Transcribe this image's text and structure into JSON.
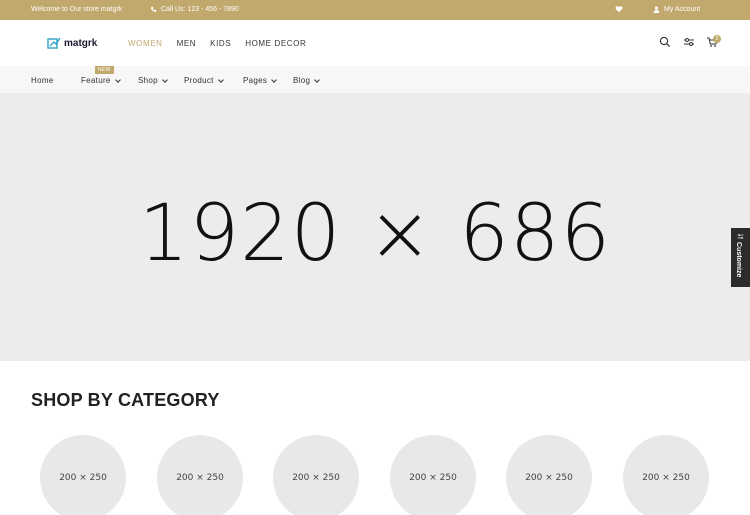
{
  "topbar": {
    "welcome": "Welcome to Our store matgrk",
    "phone": "Call Us: 123 - 456 - 7890",
    "account": "My Account"
  },
  "header": {
    "logo": "matgrk",
    "nav": [
      "WOMEN",
      "MEN",
      "KIDS",
      "HOME DECOR"
    ],
    "cart_count": "2"
  },
  "subnav": {
    "items": [
      "Home",
      "Feature",
      "Shop",
      "Product",
      "Pages",
      "Blog"
    ],
    "new_badge": "NEW"
  },
  "hero": {
    "placeholder": "1920 × 686"
  },
  "customize": {
    "label": "Customize"
  },
  "category": {
    "title": "SHOP BY CATEGORY",
    "items": [
      "200 × 250",
      "200 × 250",
      "200 × 250",
      "200 × 250",
      "200 × 250",
      "200 × 250"
    ]
  },
  "colors": {
    "accent": "#c1a86d",
    "hero_bg": "#ececec"
  }
}
